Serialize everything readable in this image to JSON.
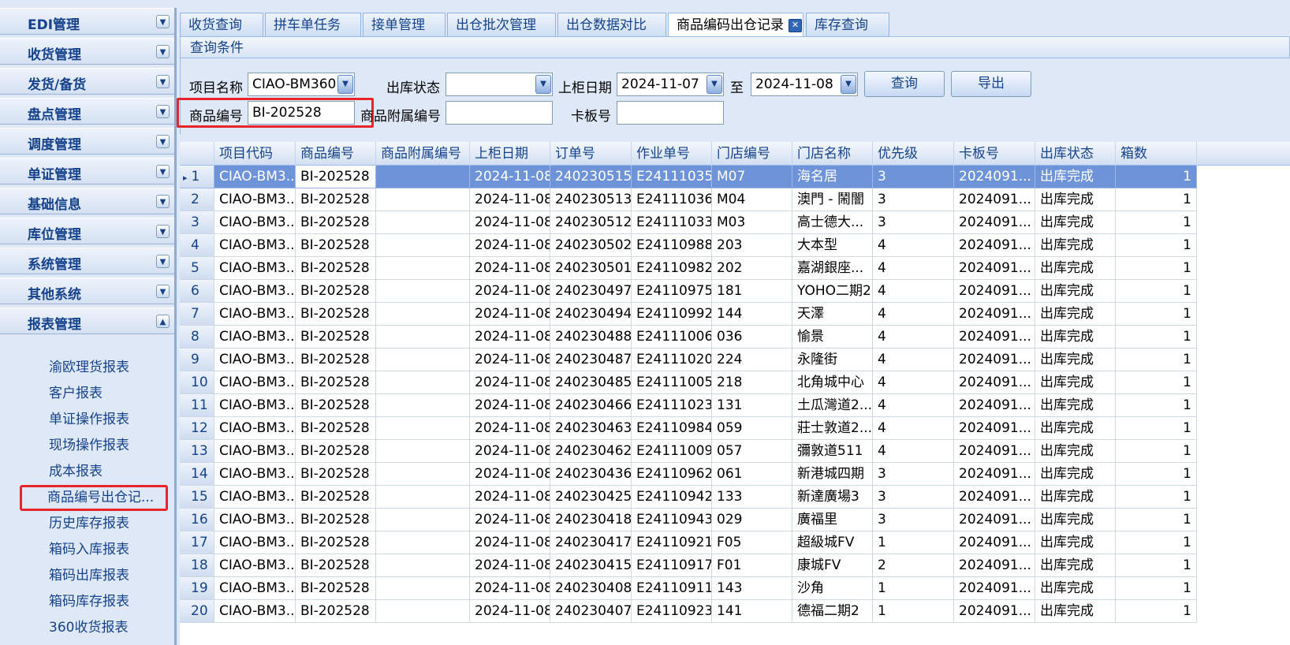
{
  "sidebar": {
    "groups": [
      "EDI管理",
      "收货管理",
      "发货/备货",
      "盘点管理",
      "调度管理",
      "单证管理",
      "基础信息",
      "库位管理",
      "系统管理",
      "其他系统",
      "报表管理"
    ],
    "items": [
      "渝欧理货报表",
      "客户报表",
      "单证操作报表",
      "现场操作报表",
      "成本报表",
      "商品编号出仓记...",
      "历史库存报表",
      "箱码入库报表",
      "箱码出库报表",
      "箱码库存报表",
      "360收货报表"
    ]
  },
  "tabs": [
    "收货查询",
    "拼车单任务",
    "接单管理",
    "出仓批次管理",
    "出仓数据对比",
    "商品编码出仓记录",
    "库存查询"
  ],
  "query": {
    "title": "查询条件",
    "project_label": "项目名称",
    "project_value": "CIAO-BM360",
    "status_label": "出库状态",
    "status_value": "",
    "date_label": "上柜日期",
    "date_from": "2024-11-07",
    "to_label": "至",
    "date_to": "2024-11-08",
    "search_button": "查询",
    "export_button": "导出",
    "product_code_label": "商品编号",
    "product_code_value": "BI-202528",
    "sub_code_label": "商品附属编号",
    "sub_code_value": "",
    "pallet_label": "卡板号",
    "pallet_value": ""
  },
  "grid": {
    "columns": [
      "项目代码",
      "商品编号",
      "商品附属编号",
      "上柜日期",
      "订单号",
      "作业单号",
      "门店编号",
      "门店名称",
      "优先级",
      "卡板号",
      "出库状态",
      "箱数"
    ],
    "selected_marker": "▸",
    "rows": [
      {
        "n": "1",
        "c": [
          "CIAO-BM3...",
          "BI-202528",
          "",
          "2024-11-08",
          "240230515",
          "E24111035",
          "M07",
          "海名居",
          "3",
          "2024091...",
          "出库完成",
          "1"
        ]
      },
      {
        "n": "2",
        "c": [
          "CIAO-BM3...",
          "BI-202528",
          "",
          "2024-11-08",
          "240230513",
          "E24111036",
          "M04",
          "澳門 - 鬧闇",
          "3",
          "2024091...",
          "出库完成",
          "1"
        ]
      },
      {
        "n": "3",
        "c": [
          "CIAO-BM3...",
          "BI-202528",
          "",
          "2024-11-08",
          "240230512",
          "E24111033",
          "M03",
          "高士德大...",
          "3",
          "2024091...",
          "出库完成",
          "1"
        ]
      },
      {
        "n": "4",
        "c": [
          "CIAO-BM3...",
          "BI-202528",
          "",
          "2024-11-08",
          "240230502",
          "E24110988",
          "203",
          "大本型",
          "4",
          "2024091...",
          "出库完成",
          "1"
        ]
      },
      {
        "n": "5",
        "c": [
          "CIAO-BM3...",
          "BI-202528",
          "",
          "2024-11-08",
          "240230501",
          "E24110982",
          "202",
          "嘉湖銀座...",
          "4",
          "2024091...",
          "出库完成",
          "1"
        ]
      },
      {
        "n": "6",
        "c": [
          "CIAO-BM3...",
          "BI-202528",
          "",
          "2024-11-08",
          "240230497",
          "E24110975",
          "181",
          "YOHO二期2",
          "4",
          "2024091...",
          "出库完成",
          "1"
        ]
      },
      {
        "n": "7",
        "c": [
          "CIAO-BM3...",
          "BI-202528",
          "",
          "2024-11-08",
          "240230494",
          "E24110992",
          "144",
          "天澤",
          "4",
          "2024091...",
          "出库完成",
          "1"
        ]
      },
      {
        "n": "8",
        "c": [
          "CIAO-BM3...",
          "BI-202528",
          "",
          "2024-11-08",
          "240230488",
          "E24111006",
          "036",
          "愉景",
          "4",
          "2024091...",
          "出库完成",
          "1"
        ]
      },
      {
        "n": "9",
        "c": [
          "CIAO-BM3...",
          "BI-202528",
          "",
          "2024-11-08",
          "240230487",
          "E24111020",
          "224",
          "永隆街",
          "4",
          "2024091...",
          "出库完成",
          "1"
        ]
      },
      {
        "n": "10",
        "c": [
          "CIAO-BM3...",
          "BI-202528",
          "",
          "2024-11-08",
          "240230485",
          "E24111005",
          "218",
          "北角城中心",
          "4",
          "2024091...",
          "出库完成",
          "1"
        ]
      },
      {
        "n": "11",
        "c": [
          "CIAO-BM3...",
          "BI-202528",
          "",
          "2024-11-08",
          "240230466",
          "E24111023",
          "131",
          "土瓜灣道2...",
          "4",
          "2024091...",
          "出库完成",
          "1"
        ]
      },
      {
        "n": "12",
        "c": [
          "CIAO-BM3...",
          "BI-202528",
          "",
          "2024-11-08",
          "240230463",
          "E24110984",
          "059",
          "莊士敦道2...",
          "4",
          "2024091...",
          "出库完成",
          "1"
        ]
      },
      {
        "n": "13",
        "c": [
          "CIAO-BM3...",
          "BI-202528",
          "",
          "2024-11-08",
          "240230462",
          "E24111009",
          "057",
          "彌敦道511",
          "4",
          "2024091...",
          "出库完成",
          "1"
        ]
      },
      {
        "n": "14",
        "c": [
          "CIAO-BM3...",
          "BI-202528",
          "",
          "2024-11-08",
          "240230436",
          "E24110962",
          "061",
          "新港城四期",
          "3",
          "2024091...",
          "出库完成",
          "1"
        ]
      },
      {
        "n": "15",
        "c": [
          "CIAO-BM3...",
          "BI-202528",
          "",
          "2024-11-08",
          "240230425",
          "E24110942",
          "133",
          "新達廣場3",
          "3",
          "2024091...",
          "出库完成",
          "1"
        ]
      },
      {
        "n": "16",
        "c": [
          "CIAO-BM3...",
          "BI-202528",
          "",
          "2024-11-08",
          "240230418",
          "E24110943",
          "029",
          "廣福里",
          "3",
          "2024091...",
          "出库完成",
          "1"
        ]
      },
      {
        "n": "17",
        "c": [
          "CIAO-BM3...",
          "BI-202528",
          "",
          "2024-11-08",
          "240230417",
          "E24110921",
          "F05",
          "超級城FV",
          "1",
          "2024091...",
          "出库完成",
          "1"
        ]
      },
      {
        "n": "18",
        "c": [
          "CIAO-BM3...",
          "BI-202528",
          "",
          "2024-11-08",
          "240230415",
          "E24110917",
          "F01",
          "康城FV",
          "2",
          "2024091...",
          "出库完成",
          "1"
        ]
      },
      {
        "n": "19",
        "c": [
          "CIAO-BM3...",
          "BI-202528",
          "",
          "2024-11-08",
          "240230408",
          "E24110911",
          "143",
          "沙角",
          "1",
          "2024091...",
          "出库完成",
          "1"
        ]
      },
      {
        "n": "20",
        "c": [
          "CIAO-BM3...",
          "BI-202528",
          "",
          "2024-11-08",
          "240230407",
          "E24110923",
          "141",
          "德福二期2",
          "1",
          "2024091...",
          "出库完成",
          "1"
        ]
      }
    ]
  }
}
